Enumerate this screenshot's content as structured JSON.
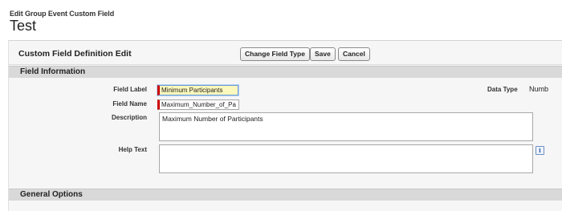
{
  "header": {
    "breadcrumb": "Edit Group Event Custom Field",
    "title": "Test"
  },
  "edit_section": {
    "title": "Custom Field Definition Edit",
    "buttons": {
      "change_field_type": "Change Field Type",
      "save": "Save",
      "cancel": "Cancel"
    }
  },
  "field_information": {
    "title": "Field Information",
    "field_label": {
      "label": "Field Label",
      "value": "Minimum Participants"
    },
    "field_name": {
      "label": "Field Name",
      "value": "Maximum_Number_of_Pa"
    },
    "description": {
      "label": "Description",
      "value": "Maximum Number of Participants"
    },
    "help_text": {
      "label": "Help Text",
      "value": ""
    },
    "data_type": {
      "label": "Data Type",
      "value": "Numb"
    }
  },
  "general_options": {
    "title": "General Options"
  },
  "icons": {
    "help_info": "info-icon"
  },
  "colors": {
    "required_bar": "#cc0000",
    "focused_input_bg": "#fdf8bd",
    "section_header_bg": "#d9d9d9"
  }
}
